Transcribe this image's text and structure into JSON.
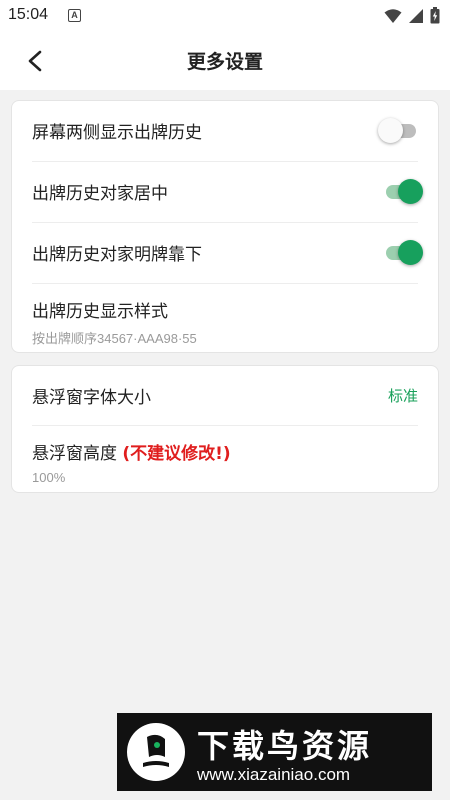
{
  "status_bar": {
    "time": "15:04",
    "notification_letter": "A",
    "icons": [
      "wifi-icon",
      "cell-signal-icon",
      "battery-icon"
    ]
  },
  "header": {
    "title": "更多设置",
    "back_icon": "chevron-left-icon"
  },
  "section1": {
    "items": [
      {
        "label": "屏幕两侧显示出牌历史",
        "toggle": false
      },
      {
        "label": "出牌历史对家居中",
        "toggle": true
      },
      {
        "label": "出牌历史对家明牌靠下",
        "toggle": true
      },
      {
        "label": "出牌历史显示样式",
        "subtitle": "按出牌顺序34567·AAA98·55"
      }
    ]
  },
  "section2": {
    "font_size": {
      "label": "悬浮窗字体大小",
      "value": "标准"
    },
    "height": {
      "label": "悬浮窗高度 ",
      "warning": "(不建议修改!)",
      "value": "100%"
    }
  },
  "watermark": {
    "title": "下载鸟资源",
    "url": "www.xiazainiao.com"
  },
  "colors": {
    "accent_green": "#17a05d",
    "warning_red": "#e01e1e",
    "background": "#f2f2f2"
  }
}
